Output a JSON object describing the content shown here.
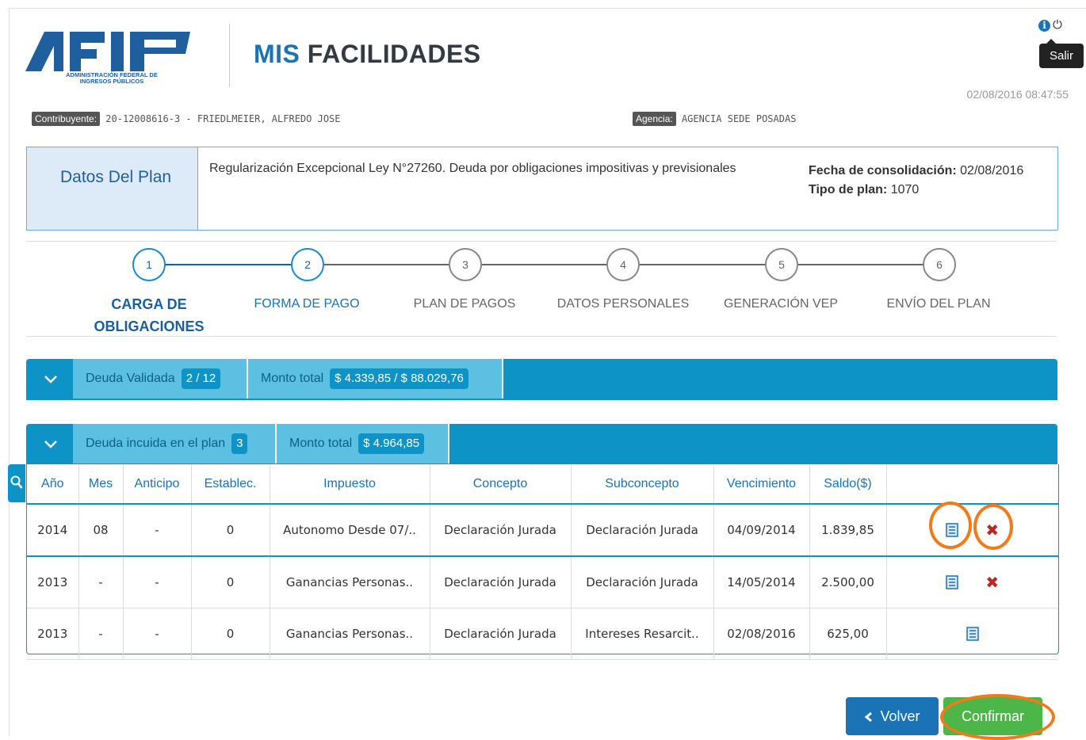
{
  "header": {
    "logo_text": "AFIP",
    "logo_subtitle": "ADMINISTRACIÓN FEDERAL DE INGRESOS PÚBLICOS",
    "app_title_1": "MIS",
    "app_title_2": "FACILIDADES",
    "logout_tooltip": "Salir",
    "datetime": "02/08/2016 08:47:55"
  },
  "infobar": {
    "contribuyente_tag": "Contribuyente:",
    "contribuyente_value": "20-12008616-3 - FRIEDLMEIER, ALFREDO JOSE",
    "agencia_tag": "Agencia:",
    "agencia_value": "AGENCIA SEDE POSADAS"
  },
  "plan": {
    "heading": "Datos Del Plan",
    "description": "Regularización Excepcional Ley N°27260. Deuda por obligaciones impositivas y previsionales",
    "fecha_label": "Fecha de consolidación:",
    "fecha_value": "02/08/2016",
    "tipo_label": "Tipo de plan:",
    "tipo_value": "1070"
  },
  "steps": [
    {
      "num": "1",
      "label": "CARGA DE OBLIGACIONES"
    },
    {
      "num": "2",
      "label": "FORMA DE PAGO"
    },
    {
      "num": "3",
      "label": "PLAN DE PAGOS"
    },
    {
      "num": "4",
      "label": "DATOS PERSONALES"
    },
    {
      "num": "5",
      "label": "GENERACIÓN VEP"
    },
    {
      "num": "6",
      "label": "ENVÍO DEL PLAN"
    }
  ],
  "validated": {
    "label": "Deuda Validada",
    "count": "2 / 12",
    "total_label": "Monto total",
    "total_value": "$ 4.339,85 / $ 88.029,76"
  },
  "included": {
    "label": "Deuda incuida en el plan",
    "count": "3",
    "total_label": "Monto total",
    "total_value": "$ 4.964,85"
  },
  "table": {
    "headers": [
      "Año",
      "Mes",
      "Anticipo",
      "Establec.",
      "Impuesto",
      "Concepto",
      "Subconcepto",
      "Vencimiento",
      "Saldo($)"
    ],
    "rows": [
      [
        "2014",
        "08",
        "-",
        "0",
        "Autonomo Desde 07/..",
        "Declaración Jurada",
        "Declaración Jurada",
        "04/09/2014",
        "1.839,85"
      ],
      [
        "2013",
        "-",
        "-",
        "0",
        "Ganancias Personas..",
        "Declaración Jurada",
        "Declaración Jurada",
        "14/05/2014",
        "2.500,00"
      ],
      [
        "2013",
        "-",
        "-",
        "0",
        "Ganancias Personas..",
        "Declaración Jurada",
        "Intereses Resarcit..",
        "02/08/2016",
        "625,00"
      ]
    ]
  },
  "buttons": {
    "back": "Volver",
    "confirm": "Confirmar"
  },
  "colors": {
    "accent": "#0d93c6",
    "brand": "#1a73b5",
    "success": "#4cb748",
    "highlight_ring": "#f07b1a"
  }
}
